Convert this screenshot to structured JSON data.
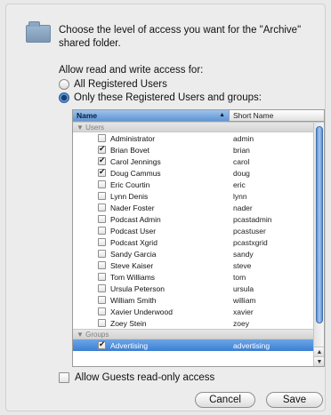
{
  "dialog": {
    "description": "Choose the level of access you want for the \"Archive\" shared folder.",
    "allow_label": "Allow read and write access for:",
    "radio_all": "All Registered Users",
    "radio_only": "Only these Registered Users and groups:",
    "selected_option": "only"
  },
  "table": {
    "col_name": "Name",
    "col_short": "Short Name",
    "group_users": "▼ Users",
    "group_groups": "▼ Groups",
    "users": [
      {
        "name": "Administrator",
        "short": "admin",
        "checked": false
      },
      {
        "name": "Brian Bovet",
        "short": "brian",
        "checked": true
      },
      {
        "name": "Carol Jennings",
        "short": "carol",
        "checked": true
      },
      {
        "name": "Doug Cammus",
        "short": "doug",
        "checked": true
      },
      {
        "name": "Eric Courtin",
        "short": "eric",
        "checked": false
      },
      {
        "name": "Lynn Denis",
        "short": "lynn",
        "checked": false
      },
      {
        "name": "Nader Foster",
        "short": "nader",
        "checked": false
      },
      {
        "name": "Podcast Admin",
        "short": "pcastadmin",
        "checked": false
      },
      {
        "name": "Podcast User",
        "short": "pcastuser",
        "checked": false
      },
      {
        "name": "Podcast Xgrid",
        "short": "pcastxgrid",
        "checked": false
      },
      {
        "name": "Sandy Garcia",
        "short": "sandy",
        "checked": false
      },
      {
        "name": "Steve Kaiser",
        "short": "steve",
        "checked": false
      },
      {
        "name": "Tom Williams",
        "short": "tom",
        "checked": false
      },
      {
        "name": "Ursula Peterson",
        "short": "ursula",
        "checked": false
      },
      {
        "name": "William Smith",
        "short": "william",
        "checked": false
      },
      {
        "name": "Xavier Underwood",
        "short": "xavier",
        "checked": false
      },
      {
        "name": "Zoey Stein",
        "short": "zoey",
        "checked": false
      }
    ],
    "groups": [
      {
        "name": "Advertising",
        "short": "advertising",
        "checked": true,
        "selected": true
      }
    ]
  },
  "guest_label": "Allow Guests read-only access",
  "buttons": {
    "cancel": "Cancel",
    "save": "Save"
  },
  "colors": {
    "selection": "#3c7fd4",
    "header_sorted": "#5f95d6"
  }
}
